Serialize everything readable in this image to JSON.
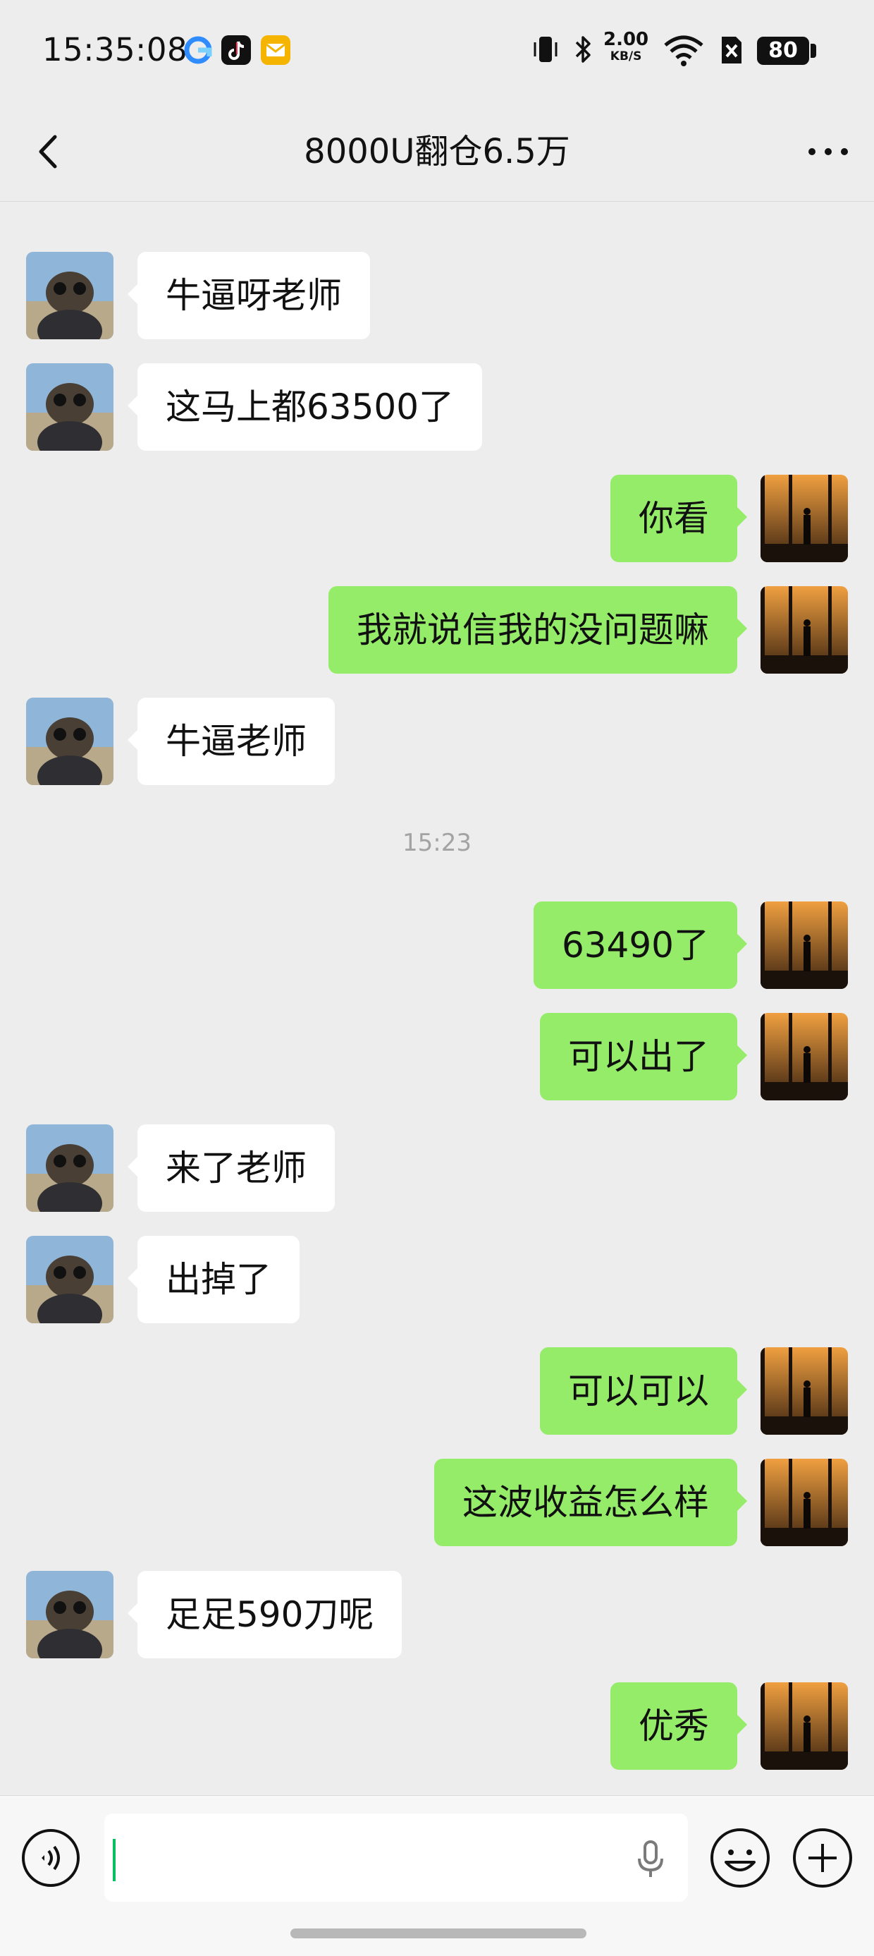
{
  "status_bar": {
    "time": "15:35:08",
    "net_speed_value": "2.00",
    "net_speed_unit": "KB/S",
    "battery": "80",
    "icons": [
      "vibrate-icon",
      "bluetooth-icon",
      "wifi-icon",
      "sim-off-icon",
      "battery-icon"
    ],
    "app_icons": [
      "browser-app-icon",
      "tiktok-app-icon",
      "mail-app-icon"
    ]
  },
  "header": {
    "title": "8000U翻仓6.5万",
    "back_icon": "chevron-left-icon",
    "more_icon": "more-dots-icon"
  },
  "colors": {
    "background": "#ededed",
    "sent_bubble": "#95ec69",
    "received_bubble": "#ffffff",
    "cursor": "#07c160"
  },
  "messages": [
    {
      "side": "left",
      "text": "牛逼呀老师"
    },
    {
      "side": "left",
      "text": "这马上都63500了"
    },
    {
      "side": "right",
      "text": "你看"
    },
    {
      "side": "right",
      "text": "我就说信我的没问题嘛"
    },
    {
      "side": "left",
      "text": "牛逼老师"
    },
    {
      "type": "time",
      "text": "15:23"
    },
    {
      "side": "right",
      "text": "63490了"
    },
    {
      "side": "right",
      "text": "可以出了"
    },
    {
      "side": "left",
      "text": "来了老师"
    },
    {
      "side": "left",
      "text": "出掉了"
    },
    {
      "side": "right",
      "text": "可以可以"
    },
    {
      "side": "right",
      "text": "这波收益怎么样"
    },
    {
      "side": "left",
      "text": "足足590刀呢"
    },
    {
      "side": "right",
      "text": "优秀"
    }
  ],
  "input_bar": {
    "voice_icon": "voice-mode-icon",
    "mic_icon": "microphone-icon",
    "emoji_icon": "emoji-icon",
    "plus_icon": "plus-icon",
    "value": ""
  }
}
